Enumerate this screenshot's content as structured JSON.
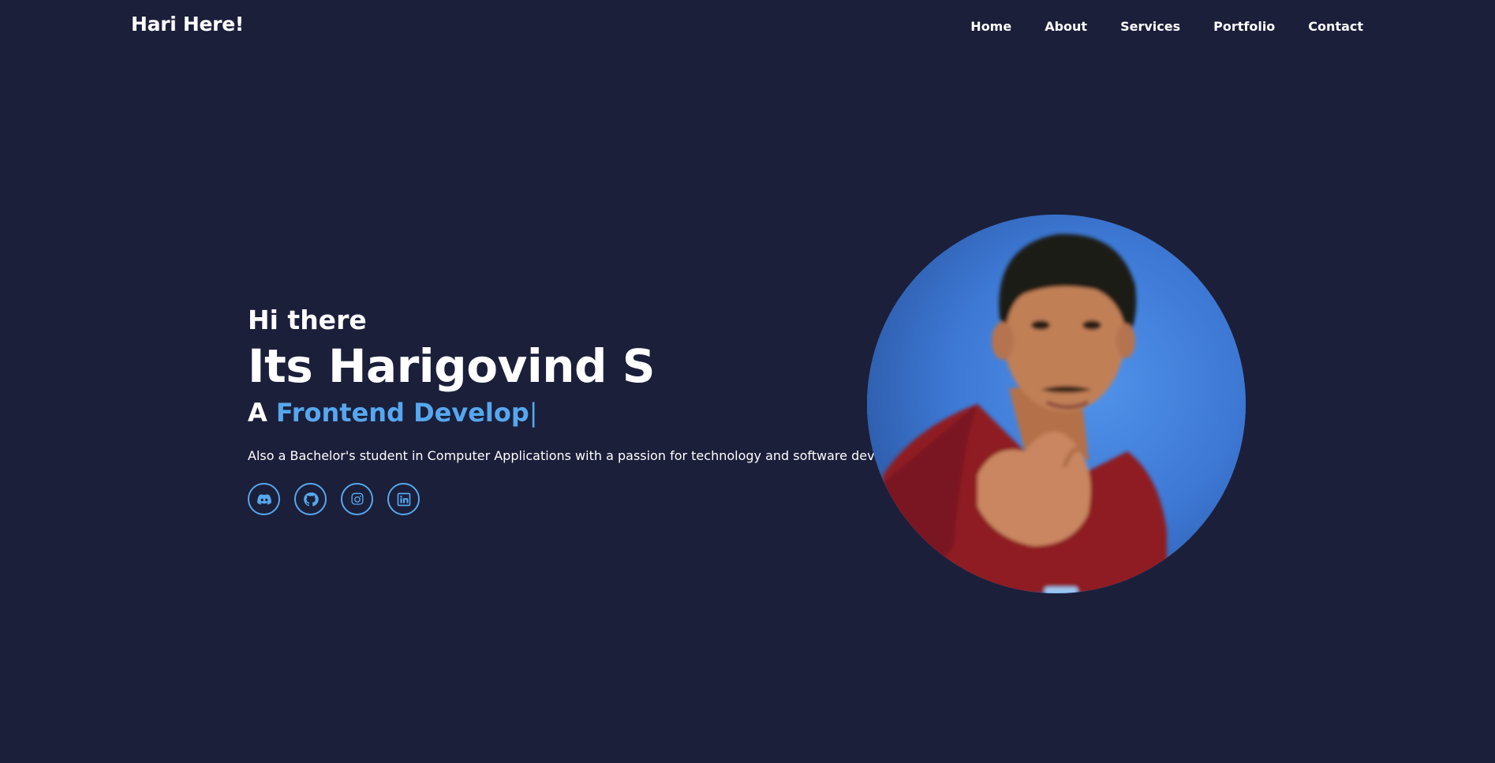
{
  "header": {
    "logo": "Hari Here!",
    "nav": [
      {
        "label": "Home"
      },
      {
        "label": "About"
      },
      {
        "label": "Services"
      },
      {
        "label": "Portfolio"
      },
      {
        "label": "Contact"
      }
    ]
  },
  "hero": {
    "greeting": "Hi there",
    "name": "Its Harigovind S",
    "role_prefix": "A ",
    "role_typed": "Frontend Develop",
    "cursor": "|",
    "description": "Also a Bachelor's student in Computer Applications with a passion for technology and software development.",
    "socials": [
      {
        "icon": "discord-icon"
      },
      {
        "icon": "github-icon"
      },
      {
        "icon": "instagram-icon"
      },
      {
        "icon": "linkedin-icon"
      }
    ]
  },
  "colors": {
    "background": "#1b1f3a",
    "accent": "#56a7ee",
    "text": "#ffffff"
  }
}
